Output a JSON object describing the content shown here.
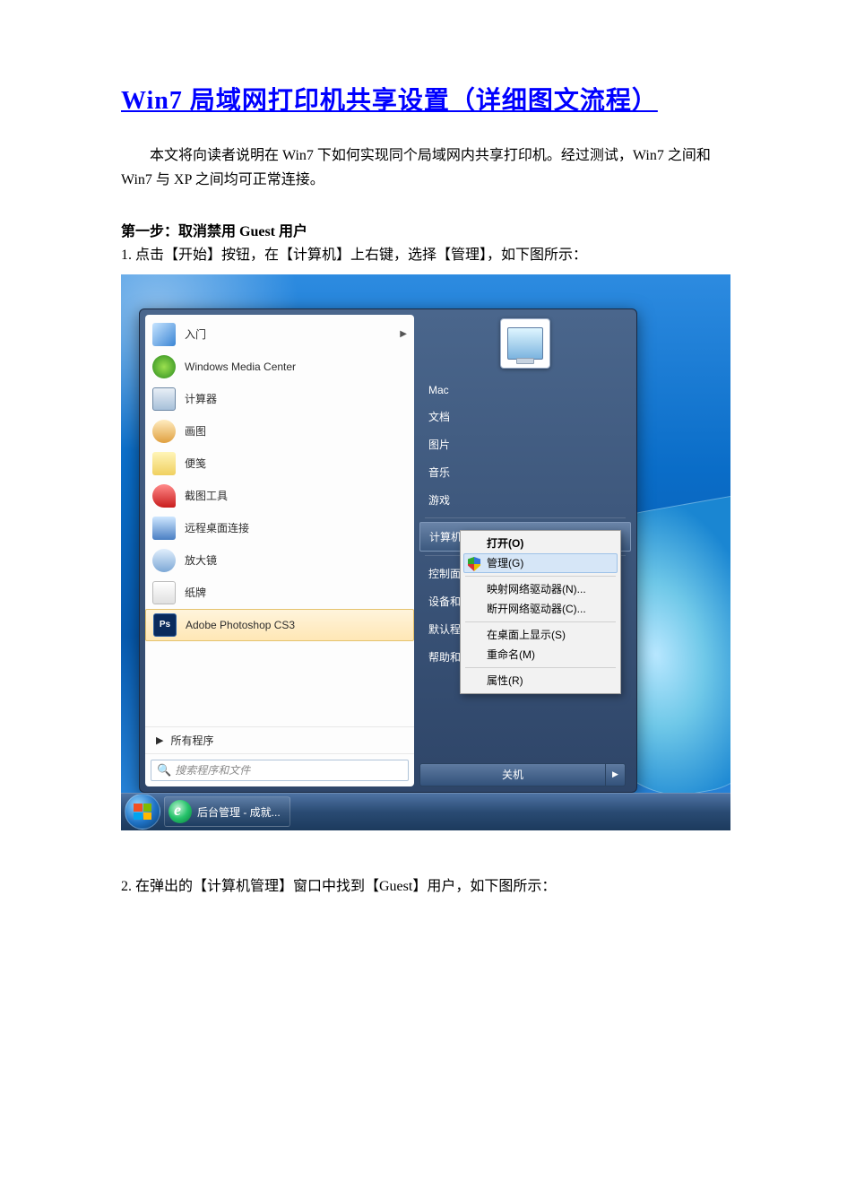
{
  "doc": {
    "title": "Win7 局域网打印机共享设置（详细图文流程）",
    "intro": "本文将向读者说明在 Win7 下如何实现同个局域网内共享打印机。经过测试，Win7 之间和 Win7 与 XP 之间均可正常连接。",
    "step1_heading": "第一步：取消禁用 Guest 用户",
    "step1_line": "1. 点击【开始】按钮，在【计算机】上右键，选择【管理】，如下图所示：",
    "step2_line": "2. 在弹出的【计算机管理】窗口中找到【Guest】用户，如下图所示："
  },
  "start_menu": {
    "programs": [
      {
        "label": "入门",
        "icon": "ic-flag",
        "arrow": true
      },
      {
        "label": "Windows Media Center",
        "icon": "ic-wmc"
      },
      {
        "label": "计算器",
        "icon": "ic-calc"
      },
      {
        "label": "画图",
        "icon": "ic-paint"
      },
      {
        "label": "便笺",
        "icon": "ic-notes"
      },
      {
        "label": "截图工具",
        "icon": "ic-snip"
      },
      {
        "label": "远程桌面连接",
        "icon": "ic-rdc"
      },
      {
        "label": "放大镜",
        "icon": "ic-mag"
      },
      {
        "label": "纸牌",
        "icon": "ic-sol"
      },
      {
        "label": "Adobe Photoshop CS3",
        "icon": "ic-ps",
        "ps": "Ps",
        "selected": true
      }
    ],
    "all_programs": "所有程序",
    "search_placeholder": "搜索程序和文件",
    "right_items": [
      "Mac",
      "文档",
      "图片",
      "音乐",
      "游戏",
      "计算机",
      "控制面",
      "设备和",
      "默认程",
      "帮助和"
    ],
    "right_highlight_index": 5,
    "shutdown": "关机"
  },
  "context_menu": {
    "items": [
      {
        "label": "打开(O)",
        "bold": true
      },
      {
        "label": "管理(G)",
        "shield": true,
        "selected": true
      },
      {
        "sep": true
      },
      {
        "label": "映射网络驱动器(N)..."
      },
      {
        "label": "断开网络驱动器(C)..."
      },
      {
        "sep": true
      },
      {
        "label": "在桌面上显示(S)"
      },
      {
        "label": "重命名(M)"
      },
      {
        "sep": true
      },
      {
        "label": "属性(R)"
      }
    ]
  },
  "taskbar": {
    "button": "后台管理 - 成就..."
  }
}
